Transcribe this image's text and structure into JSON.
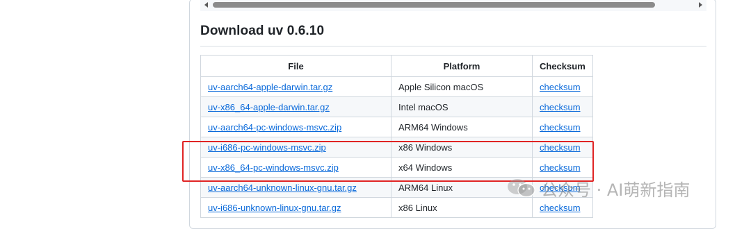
{
  "section": {
    "title": "Download uv 0.6.10"
  },
  "table": {
    "headers": [
      "File",
      "Platform",
      "Checksum"
    ],
    "rows": [
      {
        "file": "uv-aarch64-apple-darwin.tar.gz",
        "platform": "Apple Silicon macOS",
        "checksum": "checksum"
      },
      {
        "file": "uv-x86_64-apple-darwin.tar.gz",
        "platform": "Intel macOS",
        "checksum": "checksum"
      },
      {
        "file": "uv-aarch64-pc-windows-msvc.zip",
        "platform": "ARM64 Windows",
        "checksum": "checksum"
      },
      {
        "file": "uv-i686-pc-windows-msvc.zip",
        "platform": "x86 Windows",
        "checksum": "checksum"
      },
      {
        "file": "uv-x86_64-pc-windows-msvc.zip",
        "platform": "x64 Windows",
        "checksum": "checksum"
      },
      {
        "file": "uv-aarch64-unknown-linux-gnu.tar.gz",
        "platform": "ARM64 Linux",
        "checksum": "checksum"
      },
      {
        "file": "uv-i686-unknown-linux-gnu.tar.gz",
        "platform": "x86 Linux",
        "checksum": "checksum"
      }
    ]
  },
  "annotation": {
    "highlight_color": "#e02424"
  },
  "watermark": {
    "text": "公众号 · AI萌新指南",
    "icon": "wechat-icon"
  },
  "colors": {
    "link": "#0969da",
    "text": "#1f2328",
    "border": "#d0d7de"
  }
}
